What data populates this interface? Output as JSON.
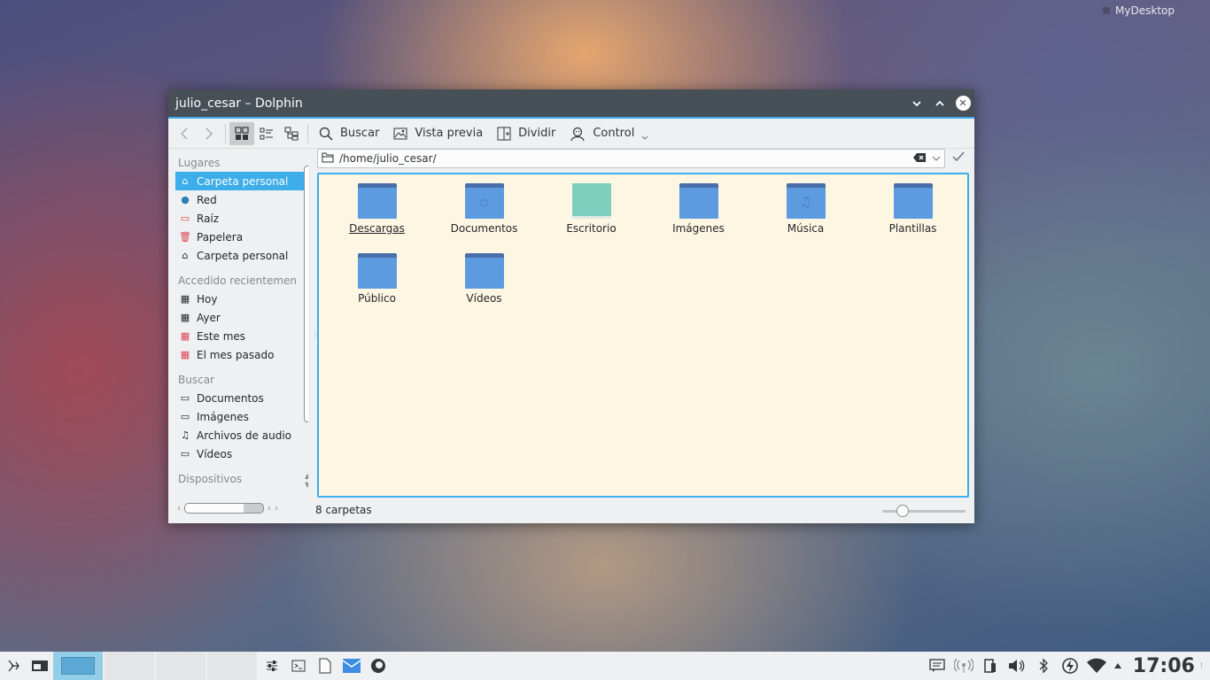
{
  "desktop": {
    "label": "MyDesktop"
  },
  "window": {
    "title": "julio_cesar – Dolphin",
    "toolbar": {
      "search_label": "Buscar",
      "preview_label": "Vista previa",
      "split_label": "Dividir",
      "control_label": "Control"
    },
    "location": {
      "path": "/home/julio_cesar/"
    },
    "sidebar": {
      "sections": [
        {
          "title": "Lugares",
          "items": [
            {
              "label": "Carpeta personal",
              "icon": "home-icon",
              "selected": true
            },
            {
              "label": "Red",
              "icon": "globe-icon"
            },
            {
              "label": "Raíz",
              "icon": "folder-red-icon"
            },
            {
              "label": "Papelera",
              "icon": "trash-icon"
            },
            {
              "label": "Carpeta personal",
              "icon": "home-icon"
            }
          ]
        },
        {
          "title": "Accedido recientemen",
          "items": [
            {
              "label": "Hoy",
              "icon": "calendar-icon"
            },
            {
              "label": "Ayer",
              "icon": "calendar-icon"
            },
            {
              "label": "Este mes",
              "icon": "calendar-icon"
            },
            {
              "label": "El mes pasado",
              "icon": "calendar-icon"
            }
          ]
        },
        {
          "title": "Buscar",
          "items": [
            {
              "label": "Documentos",
              "icon": "folder-outline-icon"
            },
            {
              "label": "Imágenes",
              "icon": "folder-outline-icon"
            },
            {
              "label": "Archivos de audio",
              "icon": "music-note-icon"
            },
            {
              "label": "Vídeos",
              "icon": "folder-outline-icon"
            }
          ]
        },
        {
          "title": "Dispositivos",
          "items": []
        }
      ]
    },
    "files": [
      {
        "name": "Descargas",
        "kind": "folder",
        "glyph": ""
      },
      {
        "name": "Documentos",
        "kind": "folder",
        "glyph": "▫"
      },
      {
        "name": "Escritorio",
        "kind": "desktop",
        "glyph": ""
      },
      {
        "name": "Imágenes",
        "kind": "folder",
        "glyph": ""
      },
      {
        "name": "Música",
        "kind": "folder",
        "glyph": "♫"
      },
      {
        "name": "Plantillas",
        "kind": "folder",
        "glyph": ""
      },
      {
        "name": "Público",
        "kind": "folder",
        "glyph": ""
      },
      {
        "name": "Vídeos",
        "kind": "folder",
        "glyph": ""
      }
    ],
    "status": {
      "text": "8 carpetas",
      "zoom_fraction": 0.2
    }
  },
  "taskbar": {
    "clock": "17:06"
  },
  "colors": {
    "accent": "#3daee9",
    "titlebar": "#475057",
    "content_bg": "#fdf6e3",
    "folder": "#5d9be0"
  }
}
